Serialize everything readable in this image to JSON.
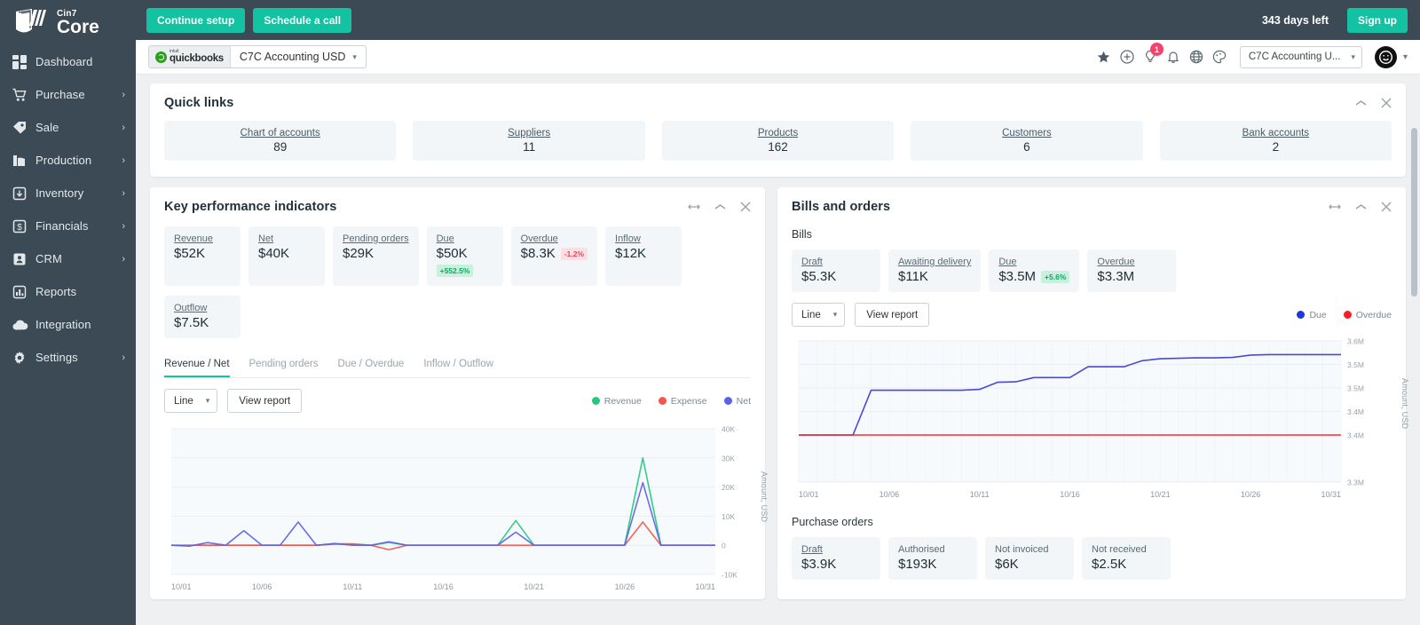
{
  "brand": {
    "name_top": "Cin7",
    "name_bottom": "Core"
  },
  "topbar": {
    "continue_setup": "Continue setup",
    "schedule_call": "Schedule a call",
    "days_left": "343 days left",
    "sign_up": "Sign up"
  },
  "sidebar": {
    "items": [
      {
        "label": "Dashboard",
        "icon": "grid-icon",
        "chevron": ""
      },
      {
        "label": "Purchase",
        "icon": "cart-icon",
        "chevron": "›"
      },
      {
        "label": "Sale",
        "icon": "tag-icon",
        "chevron": "›"
      },
      {
        "label": "Production",
        "icon": "factory-icon",
        "chevron": "›"
      },
      {
        "label": "Inventory",
        "icon": "box-down-icon",
        "chevron": "›"
      },
      {
        "label": "Financials",
        "icon": "dollar-icon",
        "chevron": "›"
      },
      {
        "label": "CRM",
        "icon": "contact-icon",
        "chevron": "›"
      },
      {
        "label": "Reports",
        "icon": "bar-chart-icon",
        "chevron": ""
      },
      {
        "label": "Integration",
        "icon": "cloud-icon",
        "chevron": ""
      },
      {
        "label": "Settings",
        "icon": "gear-icon",
        "chevron": "›"
      }
    ]
  },
  "subbar": {
    "quickbooks_label": "quickbooks",
    "quickbooks_intuit": "intuit",
    "account_name": "C7C Accounting USD",
    "notification_count": "1",
    "org_selector": "C7C Accounting U...",
    "icons": [
      "star-icon",
      "plus-circle-icon",
      "lightbulb-icon",
      "bell-icon",
      "globe-icon",
      "palette-icon"
    ]
  },
  "quick_links": {
    "title": "Quick links",
    "items": [
      {
        "label": "Chart of accounts",
        "value": "89"
      },
      {
        "label": "Suppliers",
        "value": "11"
      },
      {
        "label": "Products",
        "value": "162"
      },
      {
        "label": "Customers",
        "value": "6"
      },
      {
        "label": "Bank accounts",
        "value": "2"
      }
    ]
  },
  "kpi_panel": {
    "title": "Key performance indicators",
    "cards": [
      {
        "label": "Revenue",
        "value": "$52K",
        "chip": "",
        "chip_type": ""
      },
      {
        "label": "Net",
        "value": "$40K",
        "chip": "",
        "chip_type": ""
      },
      {
        "label": "Pending orders",
        "value": "$29K",
        "chip": "",
        "chip_type": ""
      },
      {
        "label": "Due",
        "value": "$50K",
        "chip": "+552.5%",
        "chip_type": "up-block"
      },
      {
        "label": "Overdue",
        "value": "$8.3K",
        "chip": "-1.2%",
        "chip_type": "down"
      },
      {
        "label": "Inflow",
        "value": "$12K",
        "chip": "",
        "chip_type": ""
      },
      {
        "label": "Outflow",
        "value": "$7.5K",
        "chip": "",
        "chip_type": ""
      }
    ],
    "tabs": [
      {
        "label": "Revenue / Net",
        "active": true
      },
      {
        "label": "Pending orders",
        "active": false
      },
      {
        "label": "Due / Overdue",
        "active": false
      },
      {
        "label": "Inflow / Outflow",
        "active": false
      }
    ],
    "chart_type_select": "Line",
    "view_report": "View report"
  },
  "bills_panel": {
    "title": "Bills and orders",
    "bills_heading": "Bills",
    "bills_cards": [
      {
        "label": "Draft",
        "value": "$5.3K",
        "chip": "",
        "chip_type": ""
      },
      {
        "label": "Awaiting delivery",
        "value": "$11K",
        "chip": "",
        "chip_type": ""
      },
      {
        "label": "Due",
        "value": "$3.5M",
        "chip": "+5.6%",
        "chip_type": "up"
      },
      {
        "label": "Overdue",
        "value": "$3.3M",
        "chip": "",
        "chip_type": ""
      }
    ],
    "chart_type_select": "Line",
    "view_report": "View report",
    "purchase_orders_heading": "Purchase orders",
    "po_cards": [
      {
        "label": "Draft",
        "value": "$3.9K"
      },
      {
        "label": "Authorised",
        "value": "$193K"
      },
      {
        "label": "Not invoiced",
        "value": "$6K"
      },
      {
        "label": "Not received",
        "value": "$2.5K"
      }
    ]
  },
  "colors": {
    "teal": "#12c2a0",
    "revenue": "#23c97e",
    "expense": "#f6554a",
    "net": "#5b62e8",
    "due": "#1f36dd",
    "overdue": "#f61f1f",
    "sidebar": "#3b4a54"
  },
  "chart_data": [
    {
      "id": "kpi-chart",
      "type": "line",
      "title": "Revenue / Net",
      "xlabel": "",
      "ylabel": "Amount, USD",
      "ylim": [
        -10000,
        40000
      ],
      "yticks": [
        "40K",
        "30K",
        "20K",
        "10K",
        "0",
        "-10K"
      ],
      "ytick_values": [
        40000,
        30000,
        20000,
        10000,
        0,
        -10000
      ],
      "xticks": [
        "10/01",
        "10/06",
        "10/11",
        "10/16",
        "10/21",
        "10/26",
        "10/31"
      ],
      "x": [
        "10/01",
        "10/02",
        "10/03",
        "10/04",
        "10/05",
        "10/06",
        "10/07",
        "10/08",
        "10/09",
        "10/10",
        "10/11",
        "10/12",
        "10/13",
        "10/14",
        "10/15",
        "10/16",
        "10/17",
        "10/18",
        "10/19",
        "10/20",
        "10/21",
        "10/22",
        "10/23",
        "10/24",
        "10/25",
        "10/26",
        "10/27",
        "10/28",
        "10/29",
        "10/30",
        "10/31"
      ],
      "grid": true,
      "legend_position": "top-right",
      "series": [
        {
          "name": "Revenue",
          "color": "#23c97e",
          "values": [
            0,
            0,
            0,
            0,
            0,
            0,
            0,
            0,
            0,
            500,
            500,
            0,
            1000,
            0,
            0,
            0,
            0,
            0,
            0,
            8500,
            0,
            0,
            0,
            0,
            0,
            0,
            30000,
            0,
            0,
            0,
            0
          ]
        },
        {
          "name": "Expense",
          "color": "#f6554a",
          "values": [
            0,
            0,
            0,
            0,
            0,
            0,
            0,
            0,
            0,
            400,
            400,
            0,
            -1500,
            0,
            0,
            0,
            0,
            0,
            0,
            0,
            0,
            0,
            0,
            0,
            0,
            0,
            8000,
            0,
            0,
            0,
            0
          ]
        },
        {
          "name": "Net",
          "color": "#5b62e8",
          "values": [
            0,
            -300,
            900,
            0,
            5000,
            0,
            0,
            8000,
            0,
            600,
            0,
            0,
            1200,
            0,
            0,
            0,
            0,
            0,
            0,
            4500,
            0,
            0,
            0,
            0,
            0,
            0,
            21500,
            0,
            0,
            0,
            0
          ]
        }
      ]
    },
    {
      "id": "bills-chart",
      "type": "line",
      "title": "Bills",
      "xlabel": "",
      "ylabel": "Amount, USD",
      "ylim": [
        3300000,
        3600000
      ],
      "yticks": [
        "3.6M",
        "3.5M",
        "3.5M",
        "3.4M",
        "3.4M",
        "3.3M"
      ],
      "ytick_values": [
        3600000,
        3550000,
        3500000,
        3450000,
        3400000,
        3300000
      ],
      "xticks": [
        "10/01",
        "10/06",
        "10/11",
        "10/16",
        "10/21",
        "10/26",
        "10/31"
      ],
      "x": [
        "10/01",
        "10/02",
        "10/03",
        "10/04",
        "10/05",
        "10/06",
        "10/07",
        "10/08",
        "10/09",
        "10/10",
        "10/11",
        "10/12",
        "10/13",
        "10/14",
        "10/15",
        "10/16",
        "10/17",
        "10/18",
        "10/19",
        "10/20",
        "10/21",
        "10/22",
        "10/23",
        "10/24",
        "10/25",
        "10/26",
        "10/27",
        "10/28",
        "10/29",
        "10/30",
        "10/31"
      ],
      "grid": true,
      "legend_position": "top-right",
      "series": [
        {
          "name": "Due",
          "color": "#3a3ad6",
          "values": [
            3400000,
            3400000,
            3400000,
            3400000,
            3495000,
            3495000,
            3495000,
            3495000,
            3495000,
            3495000,
            3497000,
            3512000,
            3513000,
            3522000,
            3522000,
            3522000,
            3545000,
            3545000,
            3545000,
            3558000,
            3562000,
            3563000,
            3564000,
            3564000,
            3565000,
            3570000,
            3571000,
            3571000,
            3571000,
            3571000,
            3571000
          ]
        },
        {
          "name": "Overdue",
          "color": "#f61f1f",
          "values": [
            3400000,
            3400000,
            3400000,
            3400000,
            3400000,
            3400000,
            3400000,
            3400000,
            3400000,
            3400000,
            3400000,
            3400000,
            3400000,
            3400000,
            3400000,
            3400000,
            3400000,
            3400000,
            3400000,
            3400000,
            3400000,
            3400000,
            3400000,
            3400000,
            3400000,
            3400000,
            3400000,
            3400000,
            3400000,
            3400000,
            3400000
          ]
        }
      ]
    }
  ]
}
